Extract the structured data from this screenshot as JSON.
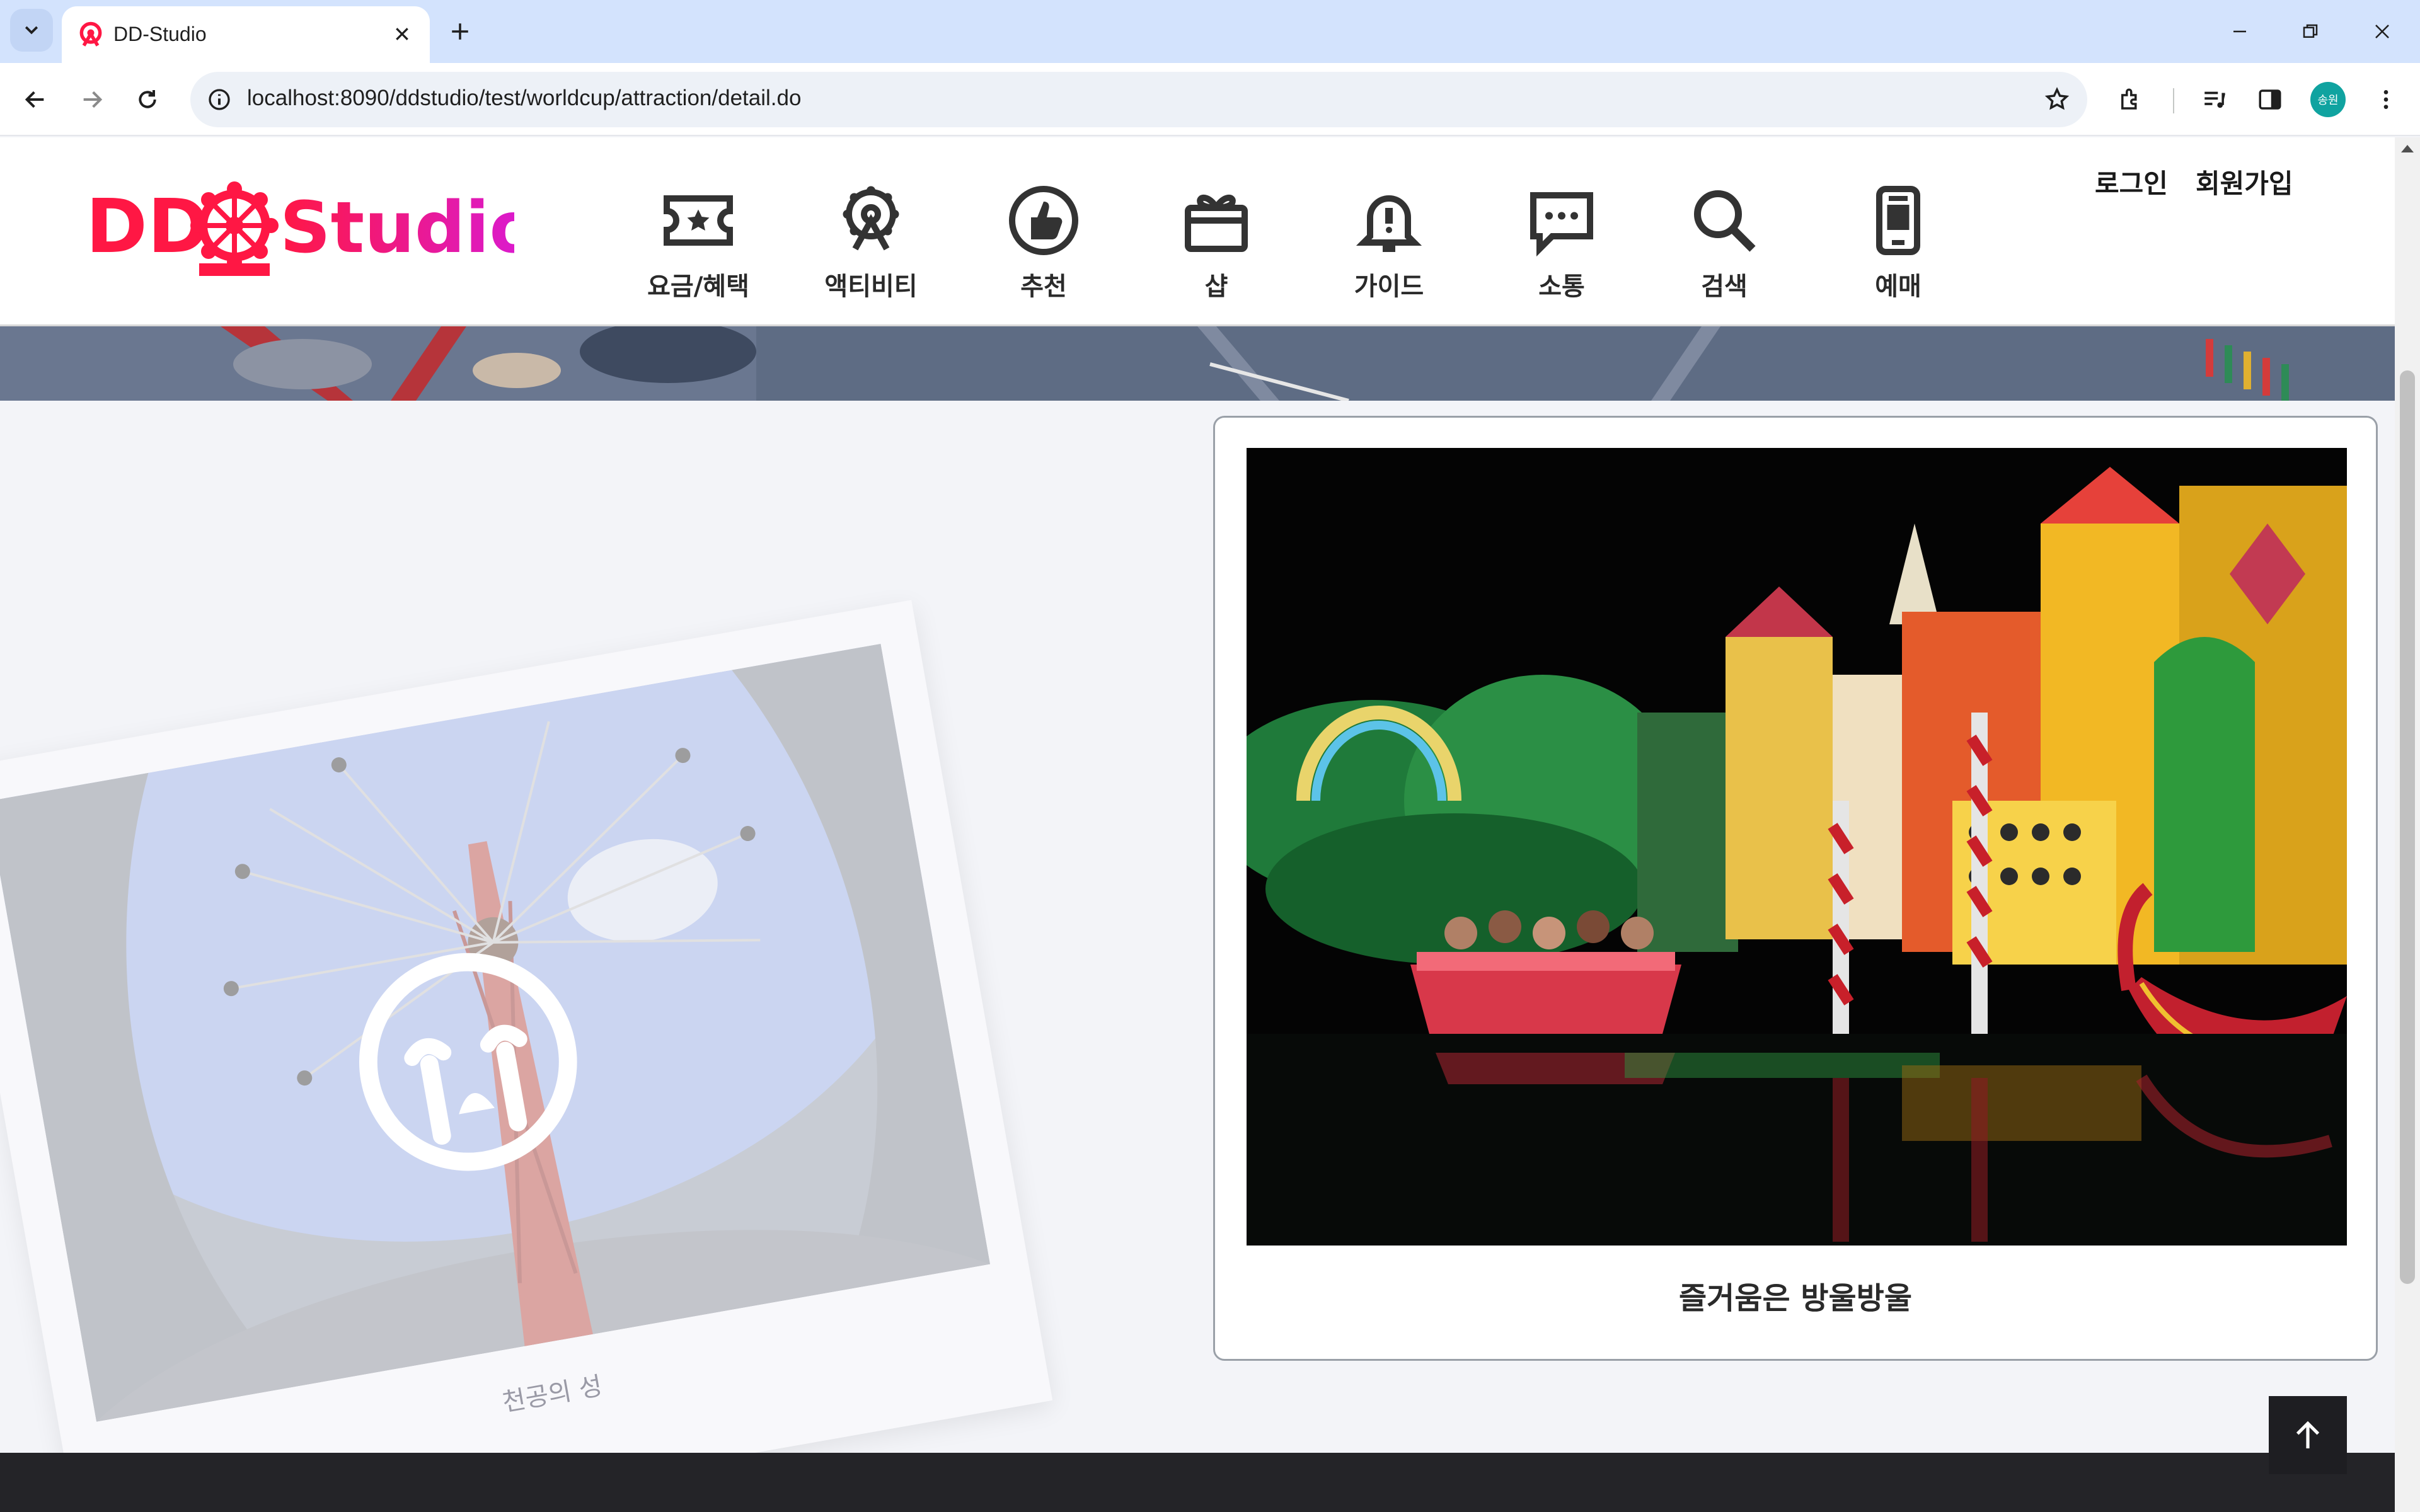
{
  "browser": {
    "tab_title": "DD-Studio",
    "url": "localhost:8090/ddstudio/test/worldcup/attraction/detail.do",
    "profile_label": "송원"
  },
  "site": {
    "logo_text": "DDStudio",
    "nav": [
      {
        "label": "요금/혜택",
        "icon": "ticket-icon"
      },
      {
        "label": "액티비티",
        "icon": "ferris-wheel-icon"
      },
      {
        "label": "추천",
        "icon": "thumbs-up-icon"
      },
      {
        "label": "샵",
        "icon": "gift-box-icon"
      },
      {
        "label": "가이드",
        "icon": "bell-icon"
      },
      {
        "label": "소통",
        "icon": "chat-bubble-icon"
      },
      {
        "label": "검색",
        "icon": "search-icon"
      },
      {
        "label": "예매",
        "icon": "mobile-ticket-icon"
      }
    ],
    "auth": {
      "login": "로그인",
      "signup": "회원가입"
    }
  },
  "worldcup": {
    "left_option": {
      "caption": "천공의 성",
      "state": "eliminated",
      "overlay_icon": "crying-face-icon"
    },
    "right_option": {
      "caption": "즐거움은 방울방울",
      "state": "selected"
    }
  },
  "colors": {
    "brand_red": "#ff1744",
    "brand_magenta": "#d81bd8",
    "tab_strip": "#d3e3fd",
    "footer": "#242428"
  }
}
